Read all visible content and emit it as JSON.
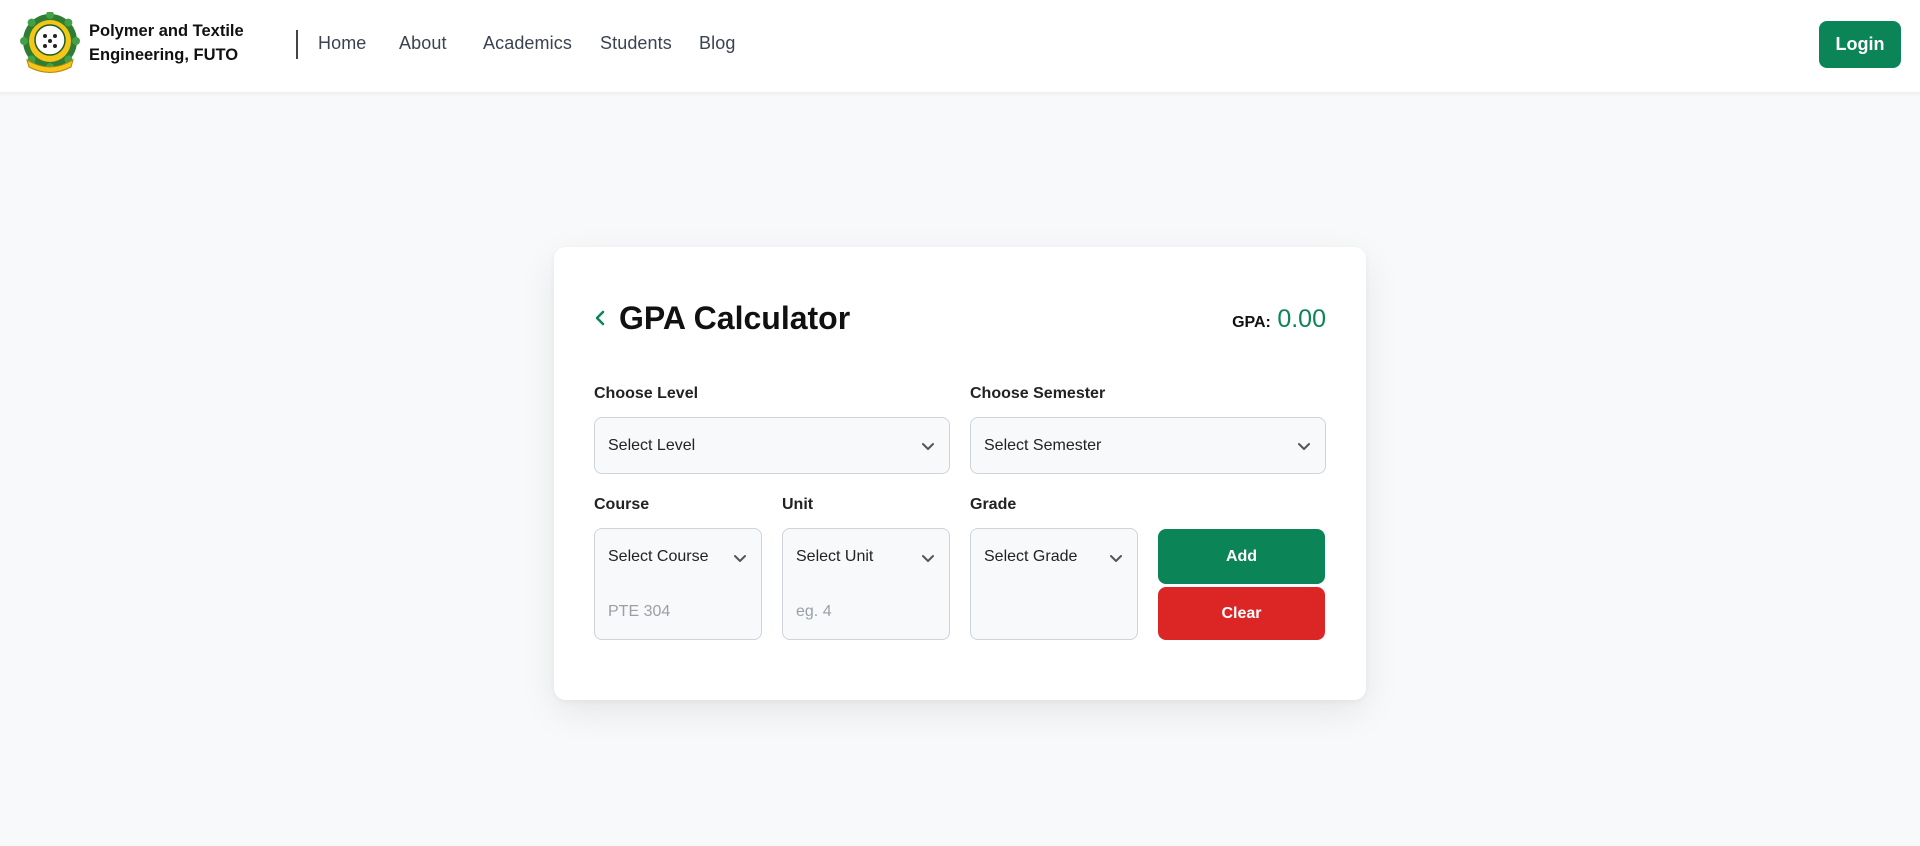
{
  "header": {
    "brand_line1": "Polymer and Textile",
    "brand_line2": "Engineering, FUTO",
    "nav": [
      "Home",
      "About",
      "Academics",
      "Students",
      "Blog"
    ],
    "login_label": "Login"
  },
  "calculator": {
    "title": "GPA Calculator",
    "gpa_label": "GPA:",
    "gpa_value": "0.00",
    "level_label": "Choose Level",
    "level_select": "Select Level",
    "semester_label": "Choose Semester",
    "semester_select": "Select Semester",
    "course_label": "Course",
    "course_select": "Select Course",
    "course_placeholder": "PTE 304",
    "unit_label": "Unit",
    "unit_select": "Select Unit",
    "unit_placeholder": "eg. 4",
    "grade_label": "Grade",
    "grade_select": "Select Grade",
    "add_label": "Add",
    "clear_label": "Clear"
  },
  "colors": {
    "accent": "#0b8457",
    "danger": "#dc2626",
    "background": "#f8f9fa"
  },
  "icons": {
    "logo": "futo-crest-logo",
    "back": "chevron-left-icon",
    "dropdown": "chevron-down-icon"
  }
}
